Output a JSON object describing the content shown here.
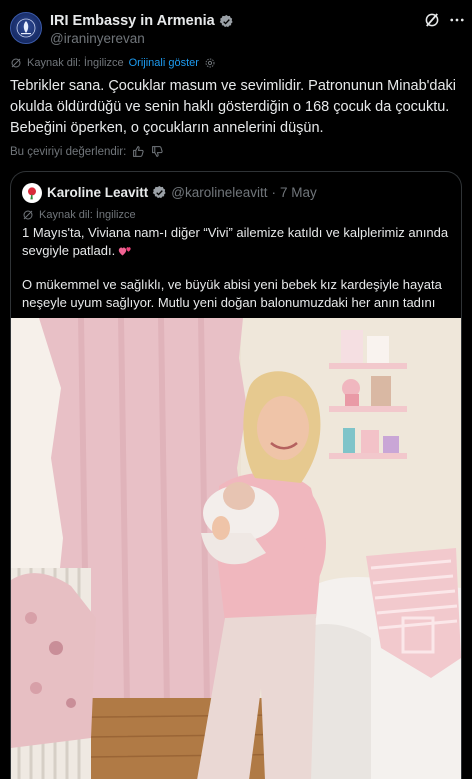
{
  "tweet": {
    "author_name": "IRI Embassy in Armenia",
    "author_handle": "@iraninyerevan",
    "source_language_label": "Kaynak dil: İngilizce",
    "show_original_label": "Orijinali göster",
    "text": "Tebrikler sana. Çocuklar masum ve sevimlidir. Patronunun Minab'daki okulda öldürdüğü ve senin haklı gösterdiğin o 168 çocuk da çocuktu. Bebeğini öperken, o çocukların annelerini düşün.",
    "rate_translation_label": "Bu çeviriyi değerlendir:"
  },
  "quoted_tweet": {
    "author_name": "Karoline Leavitt",
    "author_handle": "@karolineleavitt",
    "separator": "·",
    "date": "7 May",
    "source_language_label": "Kaynak dil: İngilizce",
    "paragraph_1": "1 Mayıs'ta, Viviana nam-ı diğer “Vivi” ailemize katıldı ve kalplerimiz anında sevgiyle patladı.",
    "paragraph_2": "O mükemmel ve sağlıklı, ve büyük abisi yeni bebek kız kardeşiyle hayata neşeyle uyum sağlıyor. Mutlu yeni doğan balonumuzdaki her anın tadını …"
  },
  "icons": {
    "verified": "verified-badge-icon",
    "grok": "grok-icon",
    "more": "more-options-icon",
    "translate": "translate-icon",
    "settings": "gear-icon",
    "thumbs_up": "thumbs-up-icon",
    "thumbs_down": "thumbs-down-icon",
    "heart_emoji": "two-hearts-emoji"
  },
  "colors": {
    "background": "#000000",
    "text_primary": "#e7e9ea",
    "text_secondary": "#71767b",
    "link_blue": "#1d9bf0",
    "border": "#2f3336"
  }
}
